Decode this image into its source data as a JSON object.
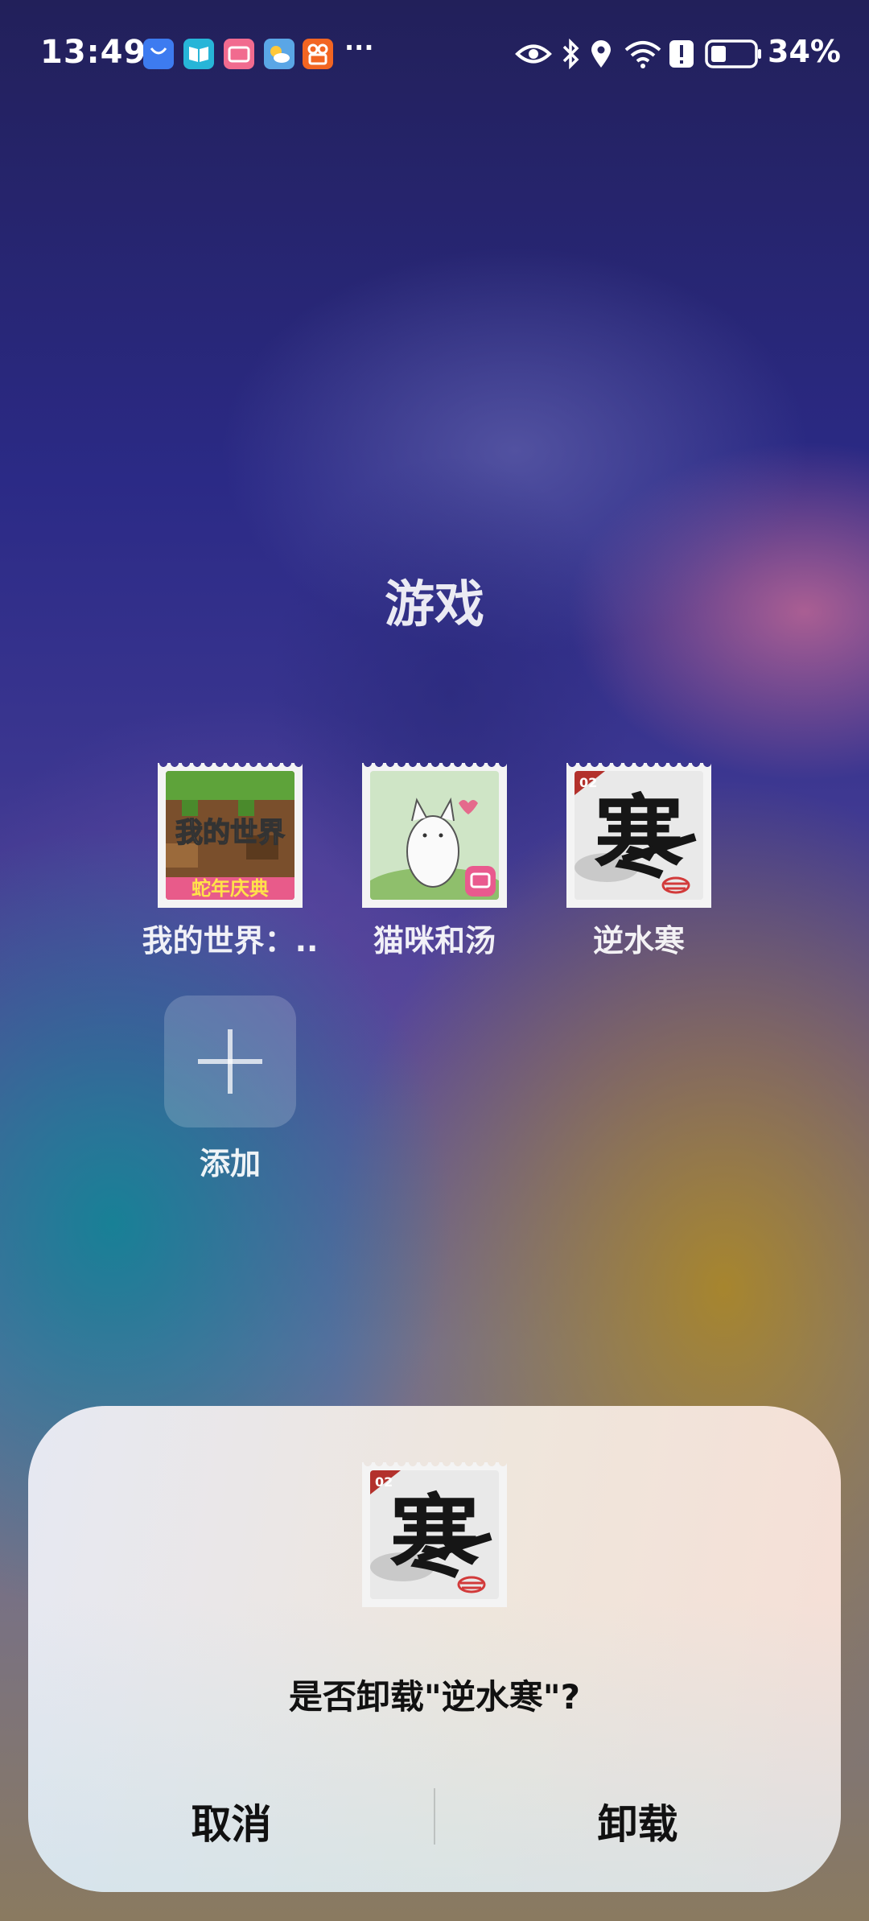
{
  "status_bar": {
    "time": "13:49",
    "battery_percent": "34%",
    "overflow_indicator": "···",
    "notification_icons": [
      "honor-store-icon",
      "book-reader-icon",
      "bilibili-app-icon",
      "weather-icon",
      "kuaishou-icon"
    ],
    "system_icons": [
      "eye-comfort-icon",
      "bluetooth-icon",
      "location-icon",
      "wifi-icon",
      "alert-icon",
      "battery-icon"
    ]
  },
  "folder": {
    "title": "游戏",
    "apps": [
      {
        "label": "我的世界：..",
        "icon": "minecraft-icon"
      },
      {
        "label": "猫咪和汤",
        "icon": "cat-soup-icon"
      },
      {
        "label": "逆水寒",
        "icon": "nishuihan-icon"
      }
    ],
    "add": {
      "label": "添加"
    }
  },
  "dialog": {
    "message": "是否卸载\"逆水寒\"?",
    "cancel_label": "取消",
    "confirm_label": "卸载"
  },
  "icon_art_text": {
    "minecraft_line1": "我的世界",
    "minecraft_line2": "蛇年庆典",
    "nishuihan_char": "寒",
    "nishuihan_badge": "02"
  }
}
